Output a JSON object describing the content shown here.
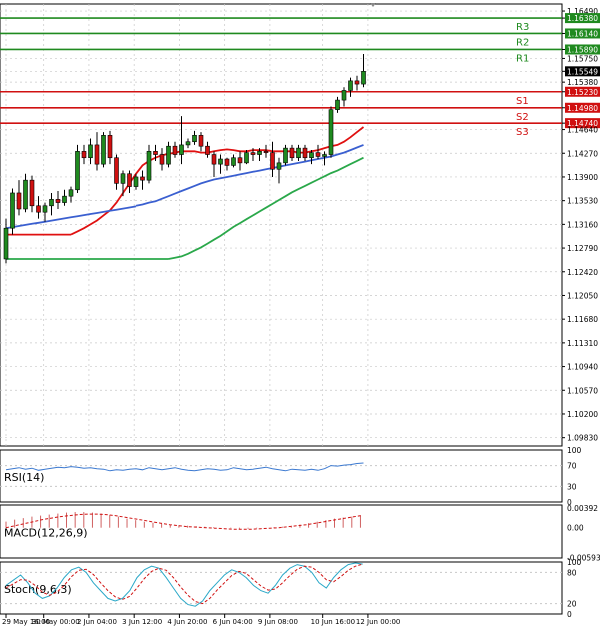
{
  "chart_data": {
    "type": "candlestick",
    "instrument_price_now": "1.15549",
    "price_axis": {
      "range": [
        1.097,
        1.166
      ],
      "ticks": [
        "1.16490",
        "1.16380",
        "1.16140",
        "1.15890",
        "1.15750",
        "1.15549",
        "1.15380",
        "1.15230",
        "1.14980",
        "1.14740",
        "1.14640",
        "1.14270",
        "1.13900",
        "1.13530",
        "1.13160",
        "1.12790",
        "1.12420",
        "1.12050",
        "1.11680",
        "1.11310",
        "1.10940",
        "1.10570",
        "1.10200",
        "1.09830"
      ],
      "tick_values": [
        1.1649,
        1.1638,
        1.1614,
        1.1589,
        1.1575,
        1.15549,
        1.1538,
        1.1523,
        1.1498,
        1.1474,
        1.1464,
        1.1427,
        1.139,
        1.1353,
        1.1316,
        1.1279,
        1.1242,
        1.1205,
        1.1168,
        1.1131,
        1.1094,
        1.1057,
        1.102,
        1.0983
      ],
      "highlighted": {
        "1.16380": "#1f8a1f",
        "1.16140": "#1f8a1f",
        "1.15890": "#1f8a1f",
        "1.15549": "#000000",
        "1.15230": "#d01010",
        "1.14980": "#d01010",
        "1.14740": "#d01010"
      }
    },
    "x_axis_labels": [
      "29 May 16:00",
      "30 May 00:00",
      "2 Jun 04:00",
      "3 Jun 12:00",
      "4 Jun 20:00",
      "6 Jun 04:00",
      "9 Jun 08:00",
      "10 Jun 16:00",
      "12 Jun 00:00"
    ],
    "x_label_index": [
      0,
      5,
      11,
      17,
      23,
      29,
      35,
      42,
      48
    ],
    "levels": [
      {
        "name": "R3",
        "value": 1.1638,
        "color": "#1f8a1f"
      },
      {
        "name": "R2",
        "value": 1.1614,
        "color": "#1f8a1f"
      },
      {
        "name": "R1",
        "value": 1.1589,
        "color": "#1f8a1f"
      },
      {
        "name": "S1",
        "value": 1.1523,
        "color": "#d01010"
      },
      {
        "name": "S2",
        "value": 1.1498,
        "color": "#d01010"
      },
      {
        "name": "S3",
        "value": 1.1474,
        "color": "#d01010"
      }
    ],
    "candles": [
      [
        1.1262,
        1.1325,
        1.1255,
        1.131
      ],
      [
        1.131,
        1.1372,
        1.13,
        1.1365
      ],
      [
        1.1365,
        1.1385,
        1.133,
        1.134
      ],
      [
        1.134,
        1.1395,
        1.1335,
        1.1385
      ],
      [
        1.1385,
        1.1392,
        1.1335,
        1.1345
      ],
      [
        1.1345,
        1.136,
        1.1325,
        1.1335
      ],
      [
        1.1335,
        1.135,
        1.132,
        1.1345
      ],
      [
        1.1345,
        1.1365,
        1.133,
        1.1355
      ],
      [
        1.1355,
        1.1368,
        1.134,
        1.135
      ],
      [
        1.135,
        1.137,
        1.1345,
        1.136
      ],
      [
        1.136,
        1.1375,
        1.135,
        1.137
      ],
      [
        1.137,
        1.144,
        1.1365,
        1.143
      ],
      [
        1.143,
        1.144,
        1.141,
        1.142
      ],
      [
        1.142,
        1.145,
        1.141,
        1.144
      ],
      [
        1.144,
        1.146,
        1.14,
        1.141
      ],
      [
        1.141,
        1.146,
        1.1405,
        1.1455
      ],
      [
        1.1455,
        1.1462,
        1.141,
        1.142
      ],
      [
        1.142,
        1.1425,
        1.137,
        1.138
      ],
      [
        1.138,
        1.14,
        1.136,
        1.1395
      ],
      [
        1.1395,
        1.14,
        1.1365,
        1.1375
      ],
      [
        1.1375,
        1.1395,
        1.137,
        1.139
      ],
      [
        1.139,
        1.14,
        1.137,
        1.1385
      ],
      [
        1.1385,
        1.144,
        1.138,
        1.143
      ],
      [
        1.143,
        1.144,
        1.1415,
        1.1425
      ],
      [
        1.1425,
        1.1435,
        1.14,
        1.141
      ],
      [
        1.141,
        1.1445,
        1.1405,
        1.1438
      ],
      [
        1.1438,
        1.1445,
        1.142,
        1.1425
      ],
      [
        1.1425,
        1.1485,
        1.141,
        1.144
      ],
      [
        1.144,
        1.145,
        1.1435,
        1.1445
      ],
      [
        1.1445,
        1.1462,
        1.144,
        1.1455
      ],
      [
        1.1455,
        1.146,
        1.143,
        1.1438
      ],
      [
        1.1438,
        1.1445,
        1.142,
        1.1425
      ],
      [
        1.1425,
        1.143,
        1.139,
        1.141
      ],
      [
        1.141,
        1.1425,
        1.1395,
        1.1418
      ],
      [
        1.1418,
        1.142,
        1.14,
        1.1408
      ],
      [
        1.1408,
        1.1425,
        1.1405,
        1.142
      ],
      [
        1.142,
        1.143,
        1.14,
        1.1412
      ],
      [
        1.1412,
        1.1432,
        1.141,
        1.1428
      ],
      [
        1.1428,
        1.1435,
        1.1415,
        1.1425
      ],
      [
        1.1425,
        1.1435,
        1.1415,
        1.143
      ],
      [
        1.143,
        1.144,
        1.142,
        1.1428
      ],
      [
        1.1428,
        1.1445,
        1.139,
        1.1402
      ],
      [
        1.1402,
        1.142,
        1.138,
        1.1412
      ],
      [
        1.1412,
        1.144,
        1.1408,
        1.1435
      ],
      [
        1.1435,
        1.144,
        1.1415,
        1.142
      ],
      [
        1.142,
        1.144,
        1.1415,
        1.1435
      ],
      [
        1.1435,
        1.144,
        1.1415,
        1.142
      ],
      [
        1.142,
        1.1432,
        1.141,
        1.1428
      ],
      [
        1.1428,
        1.144,
        1.1418,
        1.1422
      ],
      [
        1.1422,
        1.143,
        1.1408,
        1.1425
      ],
      [
        1.1425,
        1.15,
        1.142,
        1.1495
      ],
      [
        1.1495,
        1.1515,
        1.149,
        1.151
      ],
      [
        1.151,
        1.153,
        1.15,
        1.1525
      ],
      [
        1.1525,
        1.1545,
        1.1515,
        1.154
      ],
      [
        1.154,
        1.1548,
        1.1525,
        1.1535
      ],
      [
        1.1535,
        1.1582,
        1.153,
        1.15549
      ]
    ],
    "ma_fast": [
      1.13,
      1.1305,
      1.131,
      1.1316,
      1.1322,
      1.133,
      1.1338,
      1.135,
      1.1365,
      1.138,
      1.1395,
      1.1408,
      1.1415,
      1.142,
      1.1424,
      1.1426,
      1.1428,
      1.143,
      1.143,
      1.143,
      1.1428,
      1.1428,
      1.143,
      1.1432,
      1.1433,
      1.1432,
      1.143,
      1.143,
      1.1432,
      1.1432,
      1.1432,
      1.143,
      1.143,
      1.143,
      1.143,
      1.1428,
      1.1428,
      1.143,
      1.1432,
      1.1435,
      1.1438,
      1.144,
      1.1445,
      1.1452,
      1.146,
      1.1468
    ],
    "ma_medium": [
      1.1345,
      1.1347,
      1.135,
      1.1352,
      1.1356,
      1.136,
      1.1364,
      1.1368,
      1.1372,
      1.1376,
      1.138,
      1.1383,
      1.1386,
      1.1388,
      1.139,
      1.1392,
      1.1394,
      1.1396,
      1.1398,
      1.14,
      1.1402,
      1.1404,
      1.1406,
      1.1408,
      1.141,
      1.1412,
      1.1414,
      1.1416,
      1.1418,
      1.142,
      1.1422,
      1.1425,
      1.1428,
      1.1432,
      1.1436,
      1.144
    ],
    "ma_slow": [
      1.1262,
      1.1264,
      1.1266,
      1.127,
      1.1275,
      1.128,
      1.1286,
      1.1292,
      1.1298,
      1.1305,
      1.1312,
      1.1318,
      1.1324,
      1.133,
      1.1336,
      1.1342,
      1.1348,
      1.1354,
      1.136,
      1.1366,
      1.1371,
      1.1376,
      1.1381,
      1.1386,
      1.1391,
      1.1396,
      1.14,
      1.1405,
      1.141,
      1.1415,
      1.142
    ],
    "colors": {
      "ma_fast": "#e01010",
      "ma_medium": "#3a5fd0",
      "ma_slow": "#2aa84a",
      "bull": "#1f8a1f",
      "bear": "#d01010",
      "grid": "#c8c8c8"
    },
    "rsi": {
      "label": "RSI(14)",
      "ticks": [
        "100",
        "70",
        "30",
        "0"
      ],
      "tick_values": [
        100,
        70,
        30,
        0
      ],
      "values": [
        62,
        64,
        66,
        63,
        65,
        61,
        63,
        65,
        67,
        66,
        68,
        67,
        65,
        66,
        64,
        63,
        60,
        62,
        61,
        63,
        64,
        62,
        66,
        64,
        62,
        64,
        66,
        63,
        61,
        60,
        62,
        64,
        63,
        61,
        62,
        66,
        64,
        62,
        63,
        65,
        67,
        64,
        62,
        60,
        63,
        62,
        61,
        63,
        61,
        64,
        70,
        69,
        71,
        72,
        74,
        75
      ],
      "color": "#3a78d0"
    },
    "macd": {
      "label": "MACD(12,26,9)",
      "ticks": [
        "0.00392",
        "0.00",
        "-0.005934"
      ],
      "tick_values": [
        0.00392,
        0.0,
        -0.005934
      ],
      "histogram": [
        0.0012,
        0.0016,
        0.0019,
        0.0022,
        0.0024,
        0.0026,
        0.0028,
        0.003,
        0.0031,
        0.0031,
        0.003,
        0.0028,
        0.0025,
        0.0022,
        0.0018,
        0.0015,
        0.0012,
        0.001,
        0.0008,
        0.0006,
        0.0005,
        0.0004,
        0.0003,
        0.0002,
        0.0001,
        0.0,
        -0.0001,
        -0.0002,
        -0.0002,
        -0.0001,
        0.0,
        0.0001,
        0.0002,
        0.0004,
        0.0006,
        0.0009,
        0.0012,
        0.0015,
        0.0018,
        0.002,
        0.0022,
        0.0024
      ],
      "signal": [
        0.0,
        0.0004,
        0.0008,
        0.0012,
        0.0016,
        0.0019,
        0.0022,
        0.0024,
        0.0026,
        0.0027,
        0.0027,
        0.0026,
        0.0024,
        0.0021,
        0.0018,
        0.0015,
        0.0012,
        0.0009,
        0.0006,
        0.0004,
        0.0002,
        0.0001,
        0.0,
        -0.0001,
        -0.0002,
        -0.0003,
        -0.0003,
        -0.0003,
        -0.0002,
        -0.0001,
        0.0,
        0.0002,
        0.0004,
        0.0006,
        0.0009,
        0.0012,
        0.0015,
        0.0018,
        0.0021,
        0.0024
      ],
      "color_hist": "#d06060",
      "color_signal": "#d01010"
    },
    "stoch": {
      "label": "Stoch(9,6,3)",
      "ticks": [
        "100",
        "80",
        "20",
        "0"
      ],
      "tick_values": [
        100,
        80,
        20,
        0
      ],
      "k": [
        55,
        65,
        75,
        60,
        40,
        30,
        35,
        50,
        70,
        85,
        90,
        80,
        60,
        45,
        30,
        25,
        30,
        45,
        70,
        85,
        92,
        88,
        70,
        50,
        30,
        18,
        15,
        25,
        45,
        60,
        75,
        85,
        80,
        70,
        55,
        45,
        40,
        55,
        75,
        88,
        95,
        92,
        80,
        60,
        50,
        70,
        85,
        95,
        98,
        96
      ],
      "d": [
        50,
        58,
        66,
        65,
        55,
        42,
        36,
        42,
        55,
        72,
        84,
        86,
        76,
        60,
        45,
        33,
        28,
        34,
        50,
        68,
        82,
        88,
        84,
        70,
        52,
        36,
        24,
        20,
        30,
        46,
        60,
        74,
        82,
        78,
        66,
        54,
        46,
        48,
        60,
        74,
        86,
        92,
        90,
        80,
        66,
        62,
        72,
        84,
        92,
        96
      ],
      "color_k": "#2aa8c8",
      "color_d": "#d01010"
    }
  }
}
